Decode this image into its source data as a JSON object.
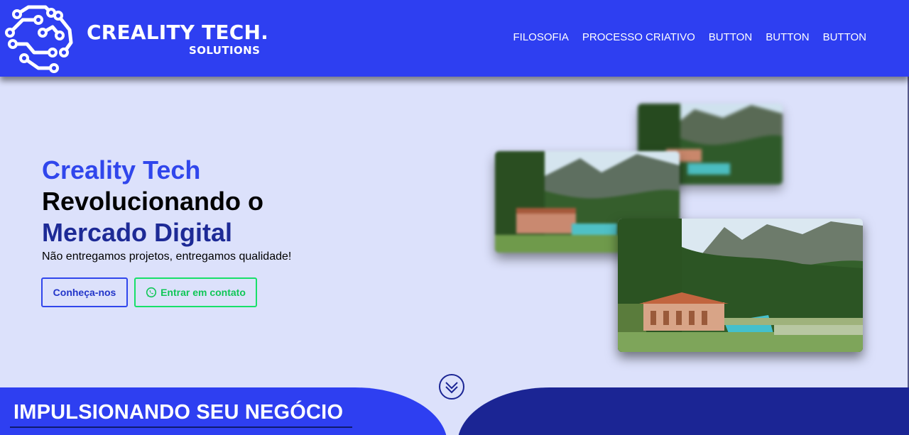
{
  "brand": {
    "name": "CREALITY TECH.",
    "tagline": "SOLUTIONS",
    "logo_icon": "circuit-hand-icon"
  },
  "nav": {
    "items": [
      {
        "label": "FILOSOFIA"
      },
      {
        "label": "PROCESSO CRIATIVO"
      },
      {
        "label": "BUTTON"
      },
      {
        "label": "BUTTON"
      },
      {
        "label": "BUTTON"
      }
    ]
  },
  "hero": {
    "title_line1": "Creality Tech",
    "title_line2": "Revolucionando o",
    "title_line3": "Mercado Digital",
    "subtitle": "Não entregamos projetos, entregamos qualidade!",
    "primary_button": "Conheça-nos",
    "secondary_button": "Entrar em contato",
    "secondary_icon": "whatsapp-icon"
  },
  "section": {
    "title": "IMPULSIONANDO SEU NEGÓCIO",
    "scroll_icon": "double-chevron-down-icon"
  },
  "colors": {
    "header": "#2e3ff1",
    "background": "#dce1fb",
    "accent_blue": "#3046ec",
    "dark_blue": "#1d2a96",
    "whatsapp_green": "#18e06a"
  }
}
